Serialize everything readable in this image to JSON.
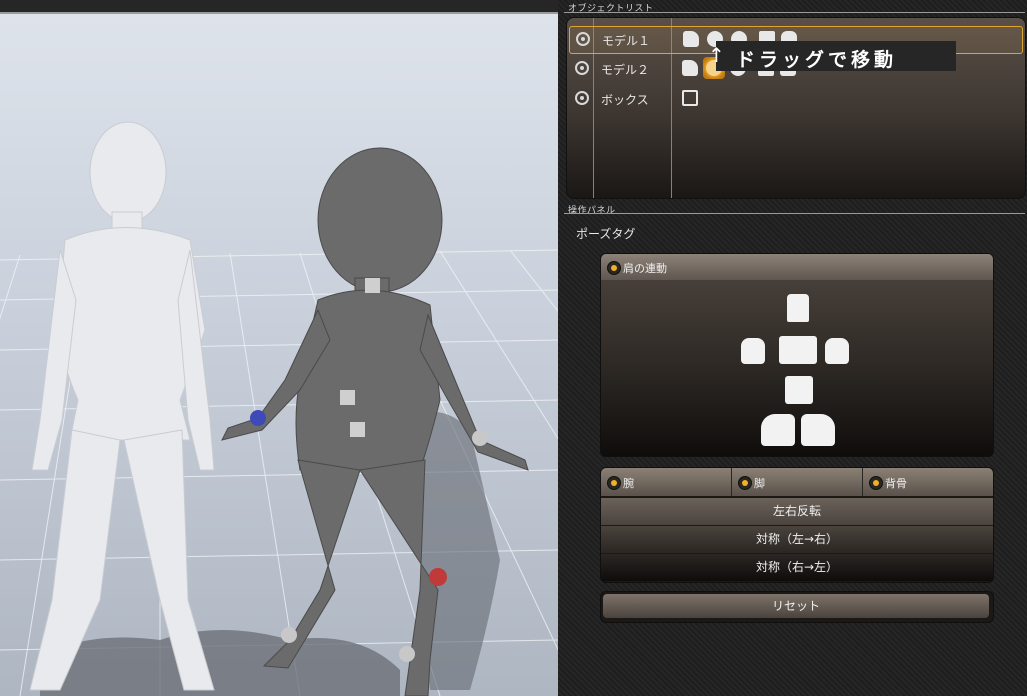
{
  "object_list": {
    "title": "オブジェクトリスト",
    "rows": [
      {
        "name": "モデル１",
        "selected": true
      },
      {
        "name": "モデル２",
        "selected": false
      },
      {
        "name": "ボックス",
        "selected": false
      }
    ]
  },
  "tooltip": {
    "arrow": "↑",
    "text": "ドラッグで移動"
  },
  "operation_panel": {
    "title": "操作パネル",
    "pose_tag": "ポーズタグ",
    "shoulder_link": "肩の連動",
    "tabs": [
      "腕",
      "脚",
      "背骨"
    ],
    "buttons": {
      "flip": "左右反転",
      "sym_lr": "対称（左→右）",
      "sym_rl": "対称（右→左）",
      "reset": "リセット"
    }
  },
  "colors": {
    "accent": "#f0b028",
    "selection_border": "#e0a530",
    "panel_bg": "#262626"
  },
  "icons": [
    "eye-icon",
    "move-person-icon",
    "rotate-joint-icon",
    "pan-icon",
    "scale-icon",
    "hand-icon",
    "box-icon"
  ]
}
